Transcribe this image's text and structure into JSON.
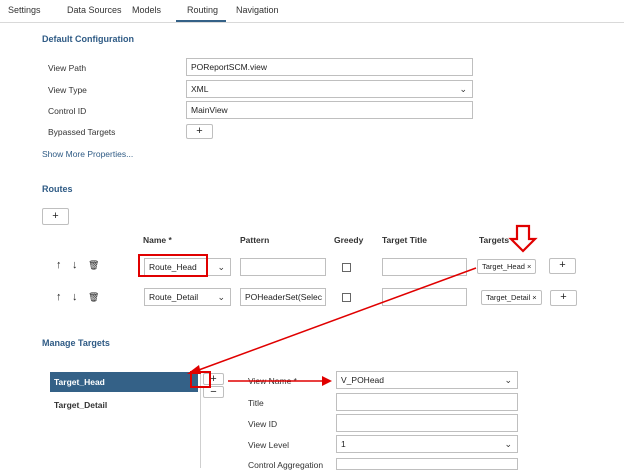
{
  "tabs": [
    "Settings",
    "Data Sources",
    "Models",
    "Routing",
    "Navigation"
  ],
  "default_config": {
    "title": "Default Configuration",
    "view_path_label": "View Path",
    "view_path_value": "POReportSCM.view",
    "view_type_label": "View Type",
    "view_type_value": "XML",
    "control_id_label": "Control ID",
    "control_id_value": "MainView",
    "bypassed_label": "Bypassed Targets",
    "add_symbol": "+",
    "show_more": "Show More Properties..."
  },
  "routes": {
    "title": "Routes",
    "add_symbol": "+",
    "columns": {
      "name": "Name *",
      "pattern": "Pattern",
      "greedy": "Greedy",
      "target_title": "Target Title",
      "targets": "Targets"
    },
    "rows": [
      {
        "up": "↑",
        "down": "↓",
        "delete": "🗑",
        "name": "Route_Head",
        "pattern": "",
        "target_title": "",
        "target_token": "Target_Head",
        "remove": "×",
        "add": "+"
      },
      {
        "up": "↑",
        "down": "↓",
        "delete": "🗑",
        "name": "Route_Detail",
        "pattern": "POHeaderSet(Selec",
        "target_title": "",
        "target_token": "Target_Detail",
        "remove": "×",
        "add": "+"
      }
    ],
    "chevron": "⌄"
  },
  "manage_targets": {
    "title": "Manage Targets",
    "items": [
      "Target_Head",
      "Target_Detail"
    ],
    "add_symbol": "+",
    "remove_symbol": "−",
    "view_name_label": "View Name *",
    "view_name_value": "V_POHead",
    "title_label": "Title",
    "view_id_label": "View ID",
    "view_level_label": "View Level",
    "view_level_value": "1",
    "control_aggregation_label": "Control Aggregation",
    "chevron": "⌄"
  },
  "annotation_color": "#e00000",
  "accent_color": "#346187"
}
